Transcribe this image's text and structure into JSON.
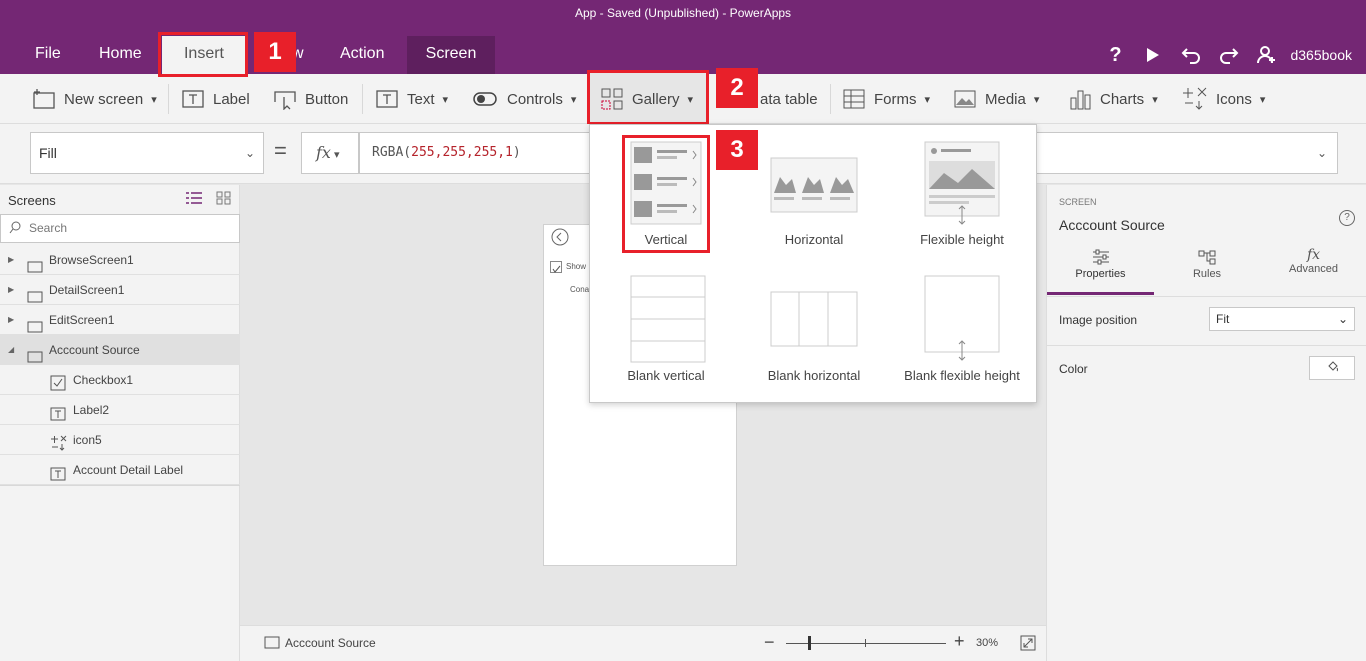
{
  "app": {
    "title": "App - Saved (Unpublished) - PowerApps",
    "user": "d365book"
  },
  "menu": {
    "file": "File",
    "home": "Home",
    "insert": "Insert",
    "view_partial": "w",
    "action": "Action",
    "screen": "Screen"
  },
  "ribbon": {
    "new_screen": "New screen",
    "label": "Label",
    "button": "Button",
    "text": "Text",
    "controls": "Controls",
    "gallery": "Gallery",
    "data_table": "ata table",
    "forms": "Forms",
    "media": "Media",
    "charts": "Charts",
    "icons": "Icons"
  },
  "formula": {
    "property": "Fill",
    "fx": "fx",
    "fn": "RGBA(",
    "args": "255,255,255,1",
    "close": ")"
  },
  "tree": {
    "header": "Screens",
    "search_placeholder": "Search",
    "items": [
      {
        "label": "BrowseScreen1",
        "level": 0,
        "arrow": "▶"
      },
      {
        "label": "DetailScreen1",
        "level": 0,
        "arrow": "▶"
      },
      {
        "label": "EditScreen1",
        "level": 0,
        "arrow": "▶"
      },
      {
        "label": "Acccount Source",
        "level": 0,
        "arrow": "◢",
        "selected": true
      },
      {
        "label": "Checkbox1",
        "level": 1,
        "icon": "checkbox-icon"
      },
      {
        "label": "Label2",
        "level": 1,
        "icon": "label-icon"
      },
      {
        "label": "icon5",
        "level": 1,
        "icon": "icons-icon"
      },
      {
        "label": "Account Detail Label",
        "level": 1,
        "icon": "label-icon"
      }
    ]
  },
  "canvas": {
    "preview_checkbox_text": "Show",
    "preview_label_text": "Cona"
  },
  "gallery_menu": {
    "vertical": "Vertical",
    "horizontal": "Horizontal",
    "flexible": "Flexible height",
    "blank_vertical": "Blank vertical",
    "blank_horizontal": "Blank horizontal",
    "blank_flexible": "Blank flexible height"
  },
  "badges": {
    "one": "1",
    "two": "2",
    "three": "3"
  },
  "right": {
    "section": "SCREEN",
    "name": "Acccount Source",
    "tabs": [
      "Properties",
      "Rules",
      "Advanced"
    ],
    "image_position_label": "Image position",
    "image_position_value": "Fit",
    "color_label": "Color"
  },
  "bottom": {
    "screen_name": "Acccount Source",
    "zoom": "30%",
    "zoom_level": 0.3
  }
}
